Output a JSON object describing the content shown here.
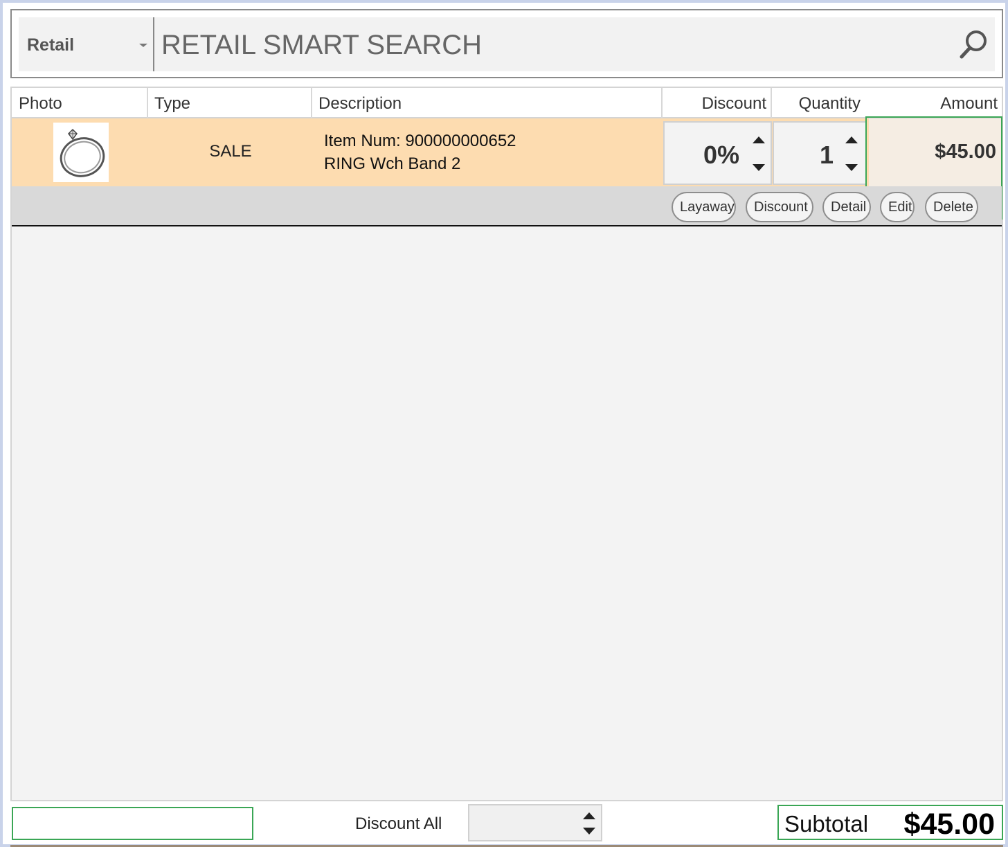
{
  "search": {
    "mode_selected": "Retail",
    "placeholder": "RETAIL SMART SEARCH",
    "icon": "search-icon"
  },
  "columns": {
    "photo": "Photo",
    "type": "Type",
    "description": "Description",
    "discount": "Discount",
    "quantity": "Quantity",
    "amount": "Amount"
  },
  "items": [
    {
      "photo_icon": "ring-photo",
      "type": "SALE",
      "description_line1": "Item Num: 900000000652",
      "description_line2": "RING Wch Band 2",
      "discount": "0%",
      "quantity": "1",
      "amount": "$45.00"
    }
  ],
  "row_actions": [
    "Layaway",
    "Discount",
    "Detail",
    "Edit",
    "Delete"
  ],
  "footer": {
    "discount_all_label": "Discount All",
    "discount_all_value": "",
    "subtotal_label": "Subtotal",
    "subtotal_value": "$45.00"
  },
  "colors": {
    "row_highlight": "#fddcb0",
    "amount_cell": "#f5ede3",
    "focus_outline": "#3aa655",
    "grid_background": "#f3f3f3"
  }
}
